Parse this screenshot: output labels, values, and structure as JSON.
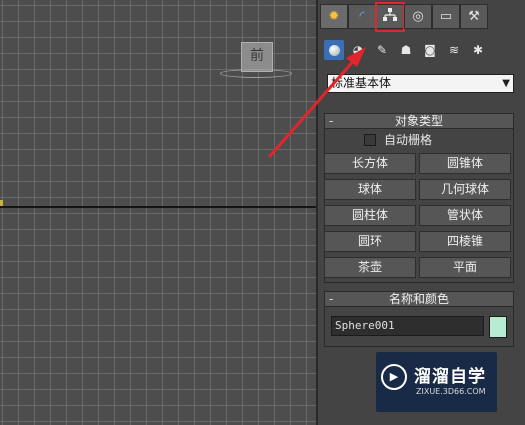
{
  "viewport": {
    "viewcube_label": "前"
  },
  "panel": {
    "main_tab_icons": [
      "create-sun-icon",
      "modify-arc-icon",
      "hierarchy-icon",
      "motion-icon",
      "display-icon",
      "utilities-hammer-icon"
    ],
    "sub_tool_icons": [
      "geometry-sphere-icon",
      "shapes-icon",
      "lights-icon",
      "cameras-icon",
      "helpers-icon",
      "space-warps-icon",
      "systems-icon"
    ],
    "dropdown_value": "标准基本体",
    "object_type": {
      "title": "对象类型",
      "collapse": "-",
      "autogrid_label": "自动栅格",
      "buttons": [
        "长方体",
        "圆锥体",
        "球体",
        "几何球体",
        "圆柱体",
        "管状体",
        "圆环",
        "四棱锥",
        "茶壶",
        "平面"
      ]
    },
    "name_color": {
      "title": "名称和颜色",
      "collapse": "-",
      "name_value": "Sphere001",
      "swatch_color": "#b6ecd1"
    }
  },
  "annotation": {
    "highlight_color": "#e0262b"
  },
  "watermark": {
    "title": "溜溜自学",
    "subtitle": "ZIXUE.3D66.COM"
  }
}
